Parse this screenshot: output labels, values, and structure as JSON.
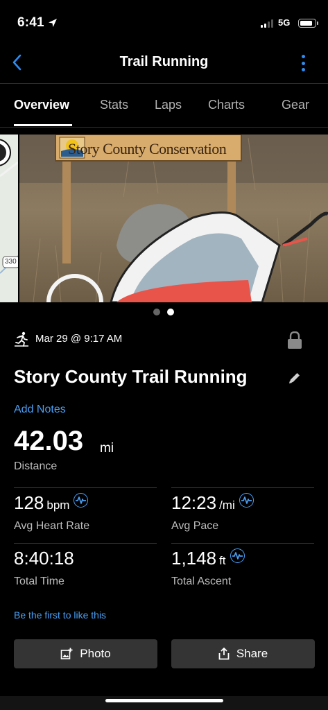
{
  "status_bar": {
    "time": "6:41",
    "network": "5G",
    "signal_bars": 4,
    "signal_bars_active": 2
  },
  "header": {
    "title": "Trail Running"
  },
  "tabs": [
    {
      "label": "Overview",
      "active": true
    },
    {
      "label": "Stats",
      "active": false
    },
    {
      "label": "Laps",
      "active": false
    },
    {
      "label": "Charts",
      "active": false
    },
    {
      "label": "Gear",
      "active": false
    }
  ],
  "carousel": {
    "sign_text": "Story County Conservation",
    "map_road_label": "330",
    "page_count": 2,
    "current_page": 2
  },
  "activity": {
    "date": "Mar 29 @ 9:17 AM",
    "name": "Story County Trail Running",
    "add_notes": "Add Notes",
    "distance": {
      "value": "42.03",
      "unit": "mi",
      "label": "Distance"
    },
    "stats": [
      {
        "value": "128",
        "unit": "bpm",
        "label": "Avg Heart Rate",
        "icon": "heart-rate-icon"
      },
      {
        "value": "12:23",
        "unit": "/mi",
        "label": "Avg Pace",
        "icon": "heart-rate-icon"
      },
      {
        "value": "8:40:18",
        "unit": "",
        "label": "Total Time",
        "icon": ""
      },
      {
        "value": "1,148",
        "unit": "ft",
        "label": "Total Ascent",
        "icon": "heart-rate-icon"
      }
    ],
    "like_text": "Be the first to like this"
  },
  "actions": {
    "photo_label": "Photo",
    "share_label": "Share"
  },
  "colors": {
    "accent": "#4a9ff5",
    "background": "#000000",
    "button": "#343434"
  }
}
